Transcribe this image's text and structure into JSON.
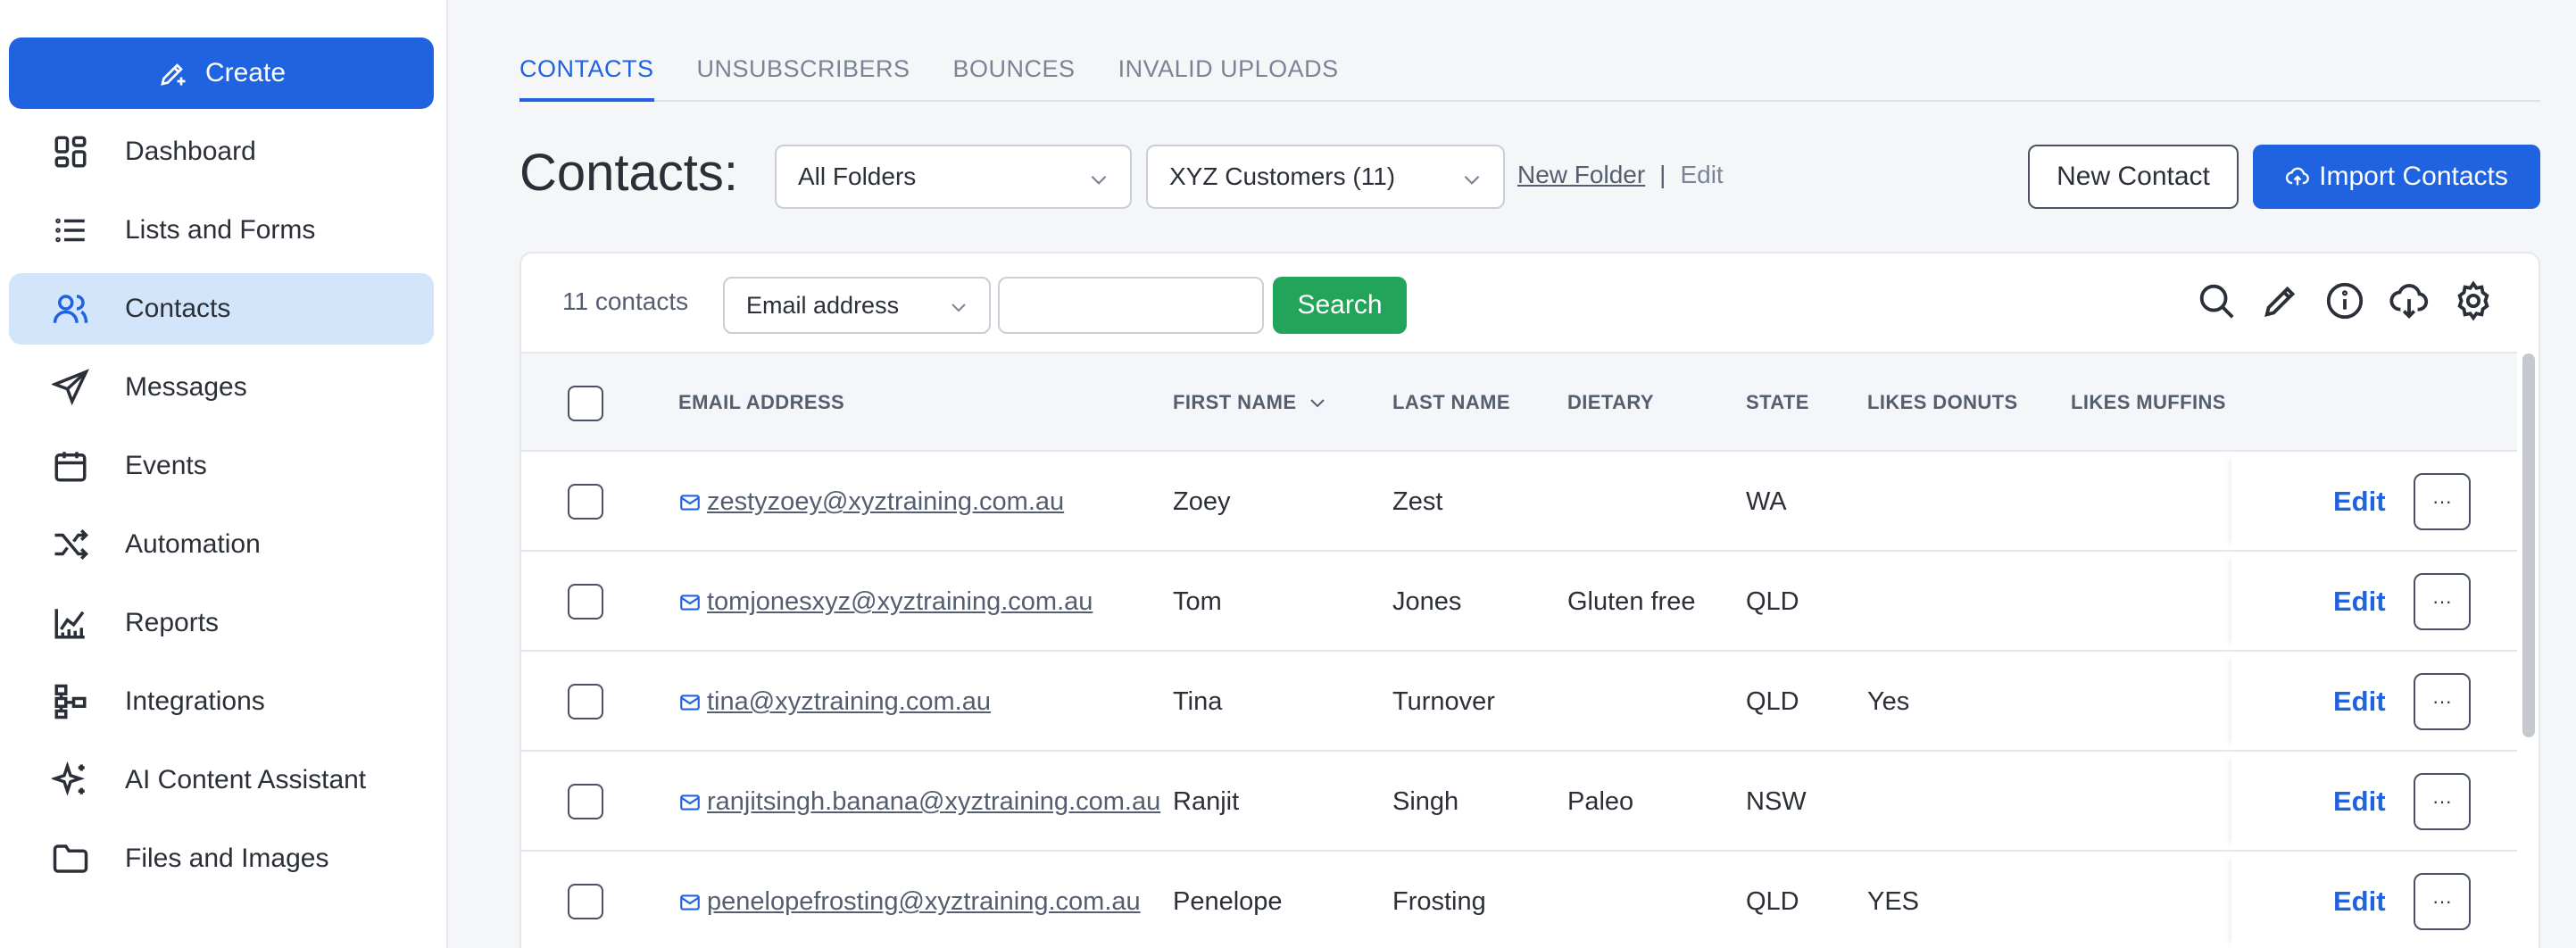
{
  "sidebar": {
    "create_label": "Create",
    "items": [
      {
        "label": "Dashboard",
        "icon": "dashboard-icon"
      },
      {
        "label": "Lists and Forms",
        "icon": "list-icon"
      },
      {
        "label": "Contacts",
        "icon": "contacts-icon",
        "active": true
      },
      {
        "label": "Messages",
        "icon": "send-icon"
      },
      {
        "label": "Events",
        "icon": "calendar-icon"
      },
      {
        "label": "Automation",
        "icon": "shuffle-icon"
      },
      {
        "label": "Reports",
        "icon": "chart-icon"
      },
      {
        "label": "Integrations",
        "icon": "integrations-icon"
      },
      {
        "label": "AI Content Assistant",
        "icon": "sparkle-icon"
      },
      {
        "label": "Files and Images",
        "icon": "folder-icon"
      }
    ]
  },
  "tabs": [
    "CONTACTS",
    "UNSUBSCRIBERS",
    "BOUNCES",
    "INVALID UPLOADS"
  ],
  "header": {
    "title": "Contacts:",
    "folder_select": "All Folders",
    "list_select": "XYZ Customers (11)",
    "new_folder": "New Folder",
    "separator": "|",
    "edit": "Edit",
    "new_contact": "New Contact",
    "import_contacts": "Import Contacts"
  },
  "toolbar": {
    "count": "11 contacts",
    "field_select": "Email address",
    "search_value": "",
    "search_label": "Search"
  },
  "table": {
    "columns": [
      "EMAIL ADDRESS",
      "FIRST NAME",
      "LAST NAME",
      "DIETARY",
      "STATE",
      "LIKES DONUTS",
      "LIKES MUFFINS"
    ],
    "rows": [
      {
        "email": "zestyzoey@xyztraining.com.au",
        "first": "Zoey",
        "last": "Zest",
        "dietary": "",
        "state": "WA",
        "donuts": "",
        "muffins": ""
      },
      {
        "email": "tomjonesxyz@xyztraining.com.au",
        "first": "Tom",
        "last": "Jones",
        "dietary": "Gluten free",
        "state": "QLD",
        "donuts": "",
        "muffins": ""
      },
      {
        "email": "tina@xyztraining.com.au",
        "first": "Tina",
        "last": "Turnover",
        "dietary": "",
        "state": "QLD",
        "donuts": "Yes",
        "muffins": ""
      },
      {
        "email": "ranjitsingh.banana@xyztraining.com.au",
        "first": "Ranjit",
        "last": "Singh",
        "dietary": "Paleo",
        "state": "NSW",
        "donuts": "",
        "muffins": ""
      },
      {
        "email": "penelopefrosting@xyztraining.com.au",
        "first": "Penelope",
        "last": "Frosting",
        "dietary": "",
        "state": "QLD",
        "donuts": "YES",
        "muffins": ""
      }
    ],
    "edit_label": "Edit",
    "more_label": "···"
  }
}
